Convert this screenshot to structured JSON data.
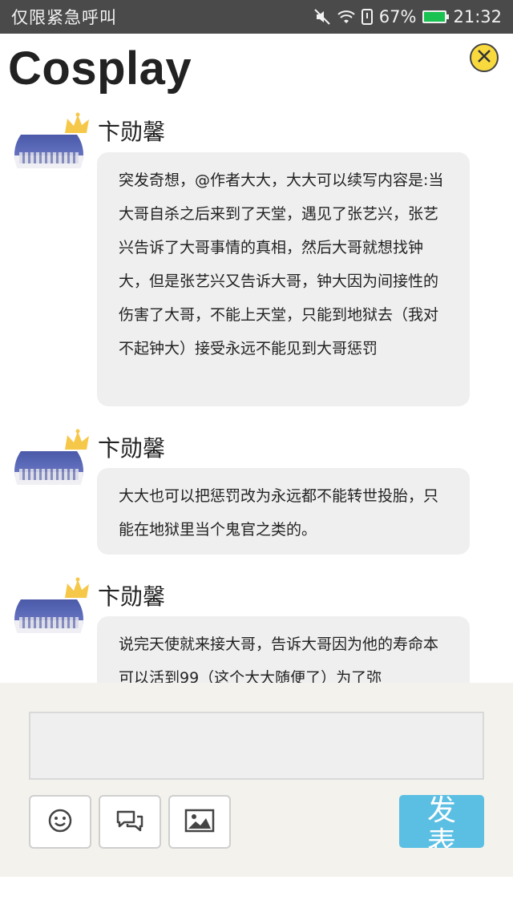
{
  "status_bar": {
    "left_text": "仅限紧急呼叫",
    "battery": "67%",
    "time": "21:32"
  },
  "header": {
    "title": "Cosplay"
  },
  "comments": [
    {
      "username": "卞勋馨",
      "text": "突发奇想，@作者大大，大大可以续写内容是:当大哥自杀之后来到了天堂，遇见了张艺兴，张艺兴告诉了大哥事情的真相，然后大哥就想找钟大，但是张艺兴又告诉大哥，钟大因为间接性的伤害了大哥，不能上天堂，只能到地狱去（我对不起钟大）接受永远不能见到大哥惩罚"
    },
    {
      "username": "卞勋馨",
      "text": "大大也可以把惩罚改为永远都不能转世投胎，只能在地狱里当个鬼官之类的。"
    },
    {
      "username": "卞勋馨",
      "text": "说完天使就来接大哥，告诉大哥因为他的寿命本可以活到99（这个大大随便了）为了弥"
    }
  ],
  "composer": {
    "input_value": "",
    "send_label": "发表",
    "tools": [
      "emoji-icon",
      "chat-icon",
      "image-icon"
    ]
  },
  "colors": {
    "accent_send": "#5bbfe3",
    "close_yellow": "#f8da3f",
    "bubble_bg": "#efefef",
    "composer_bg": "#f3f2ec"
  }
}
